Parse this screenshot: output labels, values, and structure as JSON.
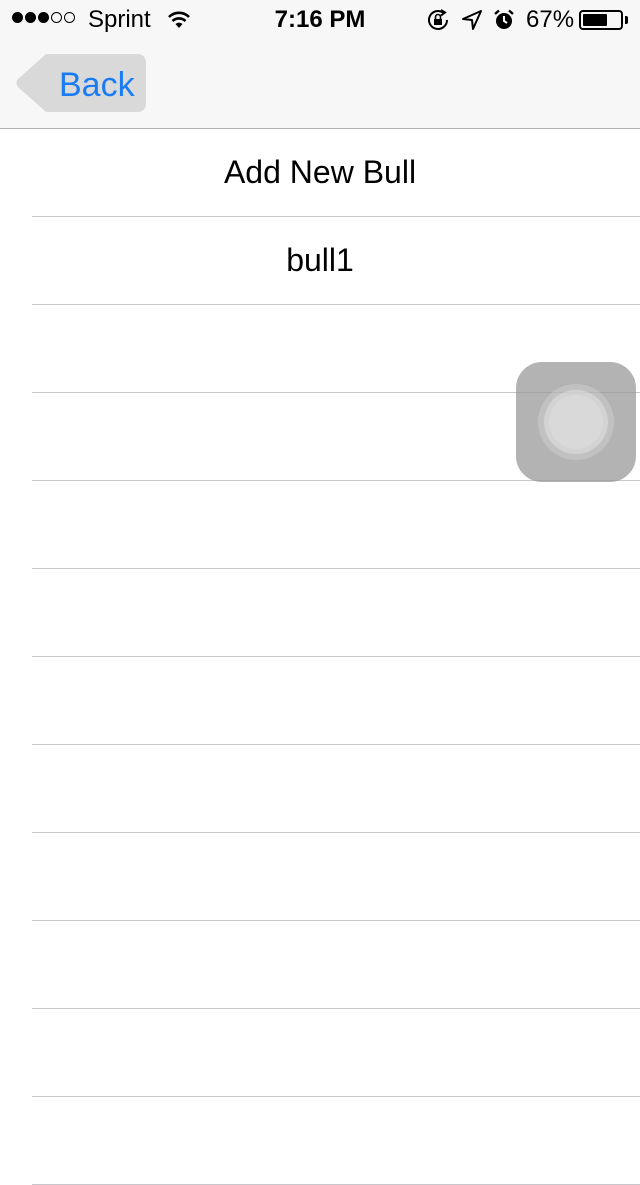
{
  "status_bar": {
    "signal": {
      "filled": 3,
      "empty": 2
    },
    "carrier": "Sprint",
    "time": "7:16 PM",
    "battery_percent": "67%",
    "battery_level": 0.67,
    "icons": [
      "wifi-icon",
      "rotation-lock-icon",
      "location-icon",
      "alarm-icon",
      "battery-icon"
    ]
  },
  "nav": {
    "back_label": "Back"
  },
  "list": {
    "rows": [
      "Add New Bull",
      "bull1",
      "",
      "",
      "",
      "",
      "",
      "",
      "",
      "",
      "",
      ""
    ]
  },
  "colors": {
    "accent": "#1a7cf5",
    "bar_background": "#f7f7f7",
    "separator": "#c8c7cc"
  }
}
